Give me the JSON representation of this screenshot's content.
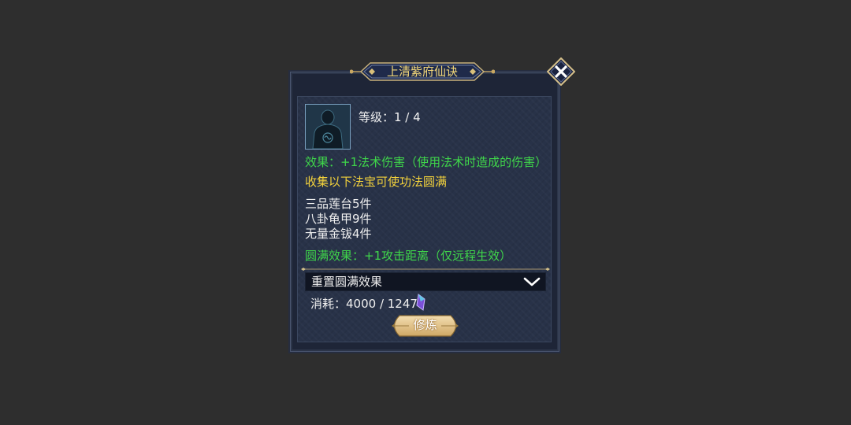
{
  "dialog": {
    "title": "上清紫府仙诀",
    "close_icon": "close-x-icon",
    "portrait_icon": "silhouette-portrait-icon",
    "level_text": "等级：1 / 4",
    "effect_text": "效果：+1法术伤害（使用法术时造成的伤害）",
    "collect_text": "收集以下法宝可使功法圆满",
    "items": [
      "三品莲台5件",
      "八卦龟甲9件",
      "无量金钹4件"
    ],
    "perfect_effect_text": "圆满效果：+1攻击距离（仅远程生效）",
    "dropdown": {
      "label": "重置圆满效果",
      "icon": "chevron-down-icon"
    },
    "cost": {
      "text": "消耗：4000 / 1247",
      "icon": "purple-crystal-icon"
    },
    "train_button": "修炼"
  },
  "colors": {
    "background": "#2e2e2e",
    "panel": "#283248",
    "title_gold": "#f2d77a",
    "effect_green": "#3fd64a",
    "notice_yellow": "#f3d23c",
    "button_tan": "#e3c88f"
  }
}
